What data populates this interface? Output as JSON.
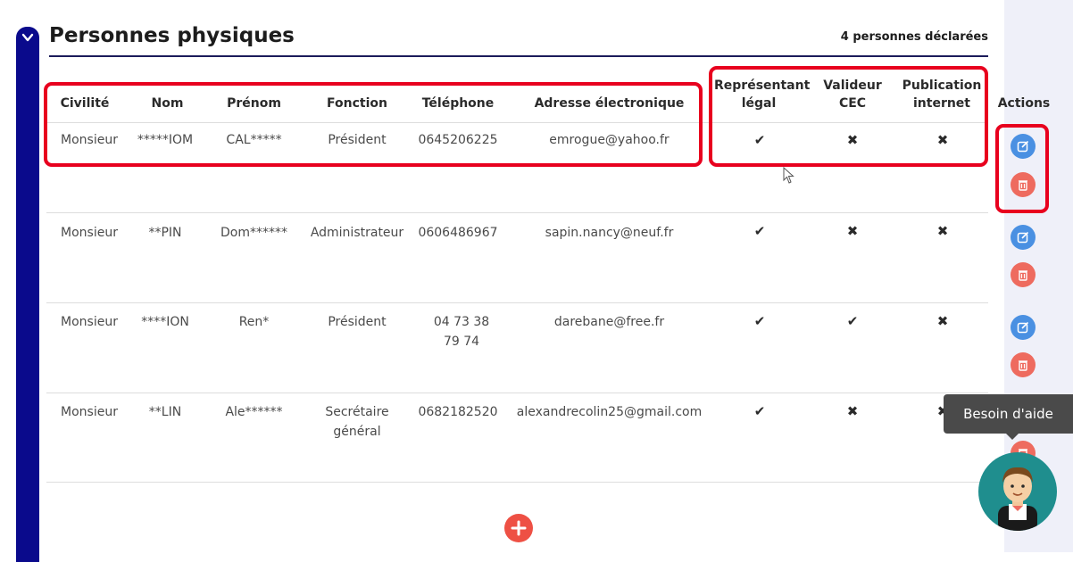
{
  "section": {
    "title": "Personnes physiques",
    "count_label": "4 personnes déclarées"
  },
  "table": {
    "columns": {
      "civilite": "Civilité",
      "nom": "Nom",
      "prenom": "Prénom",
      "fonction": "Fonction",
      "telephone": "Téléphone",
      "email": "Adresse électronique",
      "representant_l1": "Représentant",
      "representant_l2": "légal",
      "valideur_l1": "Valideur",
      "valideur_l2": "CEC",
      "publication_l1": "Publication",
      "publication_l2": "internet",
      "actions": "Actions"
    },
    "rows": [
      {
        "civilite": "Monsieur",
        "nom": "*****IOM",
        "prenom": "CAL*****",
        "fonction": "Président",
        "telephone": "0645206225",
        "email": "emrogue@yahoo.fr",
        "representant": "yes",
        "valideur": "no",
        "publication": "no"
      },
      {
        "civilite": "Monsieur",
        "nom": "**PIN",
        "prenom": "Dom******",
        "fonction": "Administrateur",
        "telephone": "0606486967",
        "email": "sapin.nancy@neuf.fr",
        "representant": "yes",
        "valideur": "no",
        "publication": "no"
      },
      {
        "civilite": "Monsieur",
        "nom": "****ION",
        "prenom": "Ren*",
        "fonction": "Président",
        "telephone": "04 73 38 79 74",
        "email": "darebane@free.fr",
        "representant": "yes",
        "valideur": "yes",
        "publication": "no"
      },
      {
        "civilite": "Monsieur",
        "nom": "**LIN",
        "prenom": "Ale******",
        "fonction": "Secrétaire général",
        "telephone": "0682182520",
        "email": "alexandrecolin25@gmail.com",
        "representant": "yes",
        "valideur": "no",
        "publication": "partial"
      }
    ]
  },
  "icons": {
    "check": "✔",
    "cross": "✖",
    "edit": "pencil-square-icon",
    "delete": "trash-icon",
    "add": "plus-icon",
    "toggle": "chevron-down-icon"
  },
  "help": {
    "label": "Besoin d'aide"
  },
  "colors": {
    "accent_navy": "#0a0a8c",
    "edit_blue": "#4a90e2",
    "delete_red": "#ee6b5f",
    "highlight_red": "#e8001e",
    "help_bg": "#4a4a4a",
    "avatar_bg": "#1f8e8e"
  }
}
